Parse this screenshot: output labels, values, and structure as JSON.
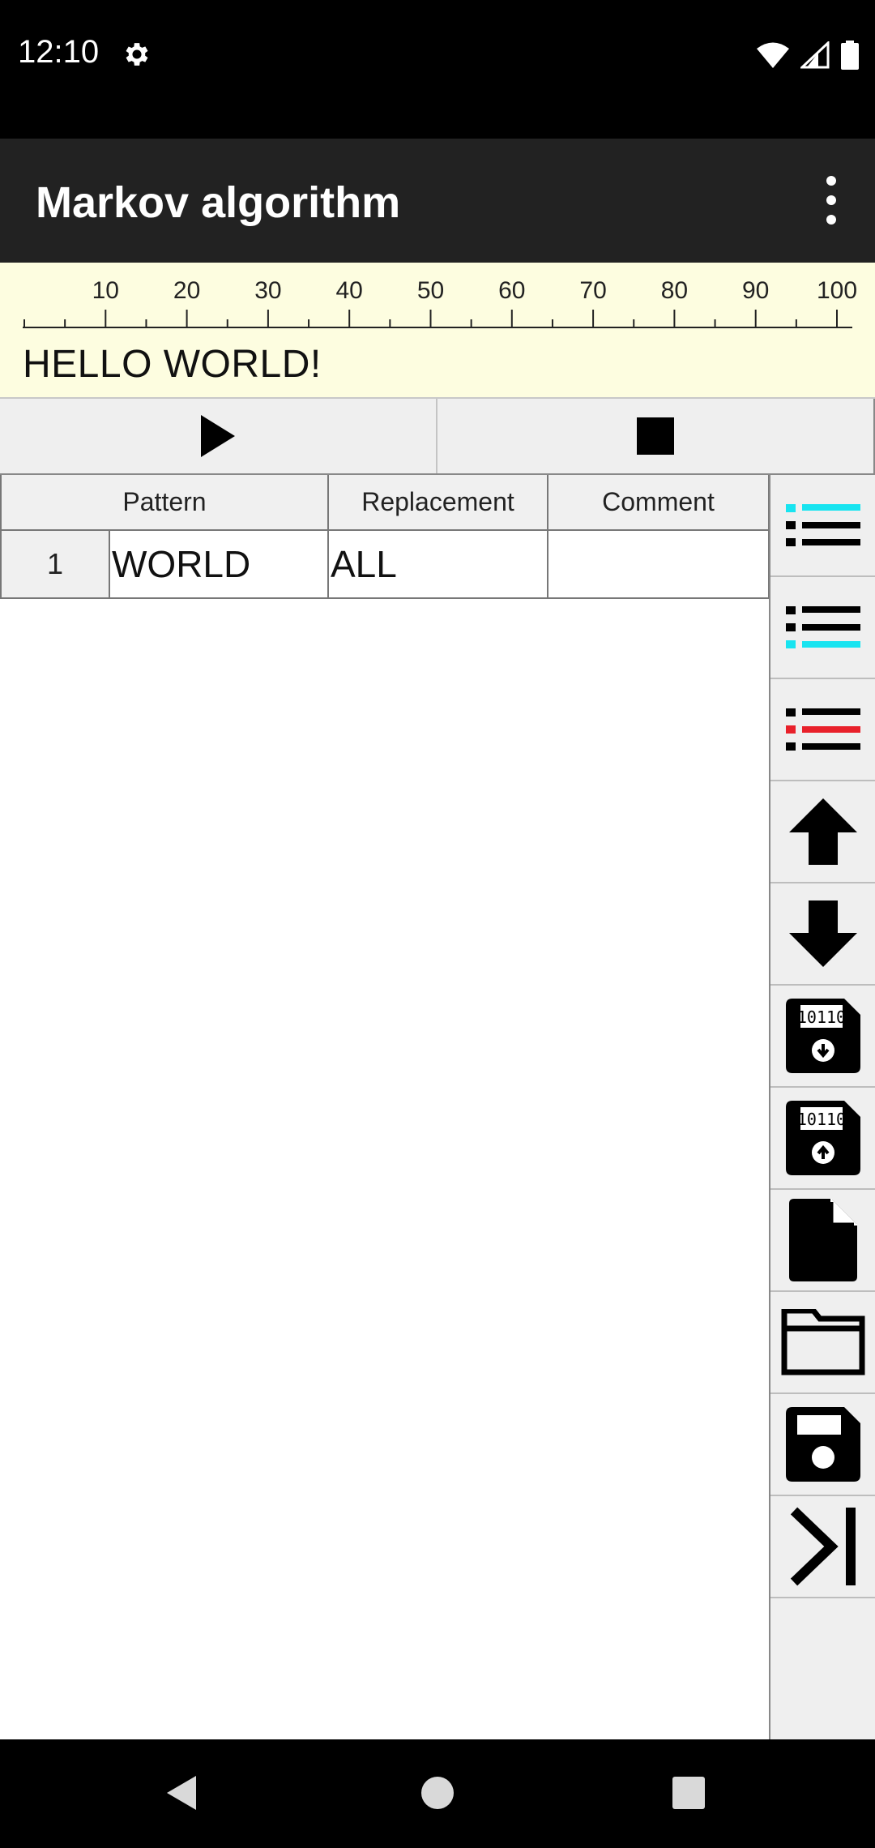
{
  "status_bar": {
    "time": "12:10",
    "settings_icon": "gear-icon",
    "wifi_icon": "wifi-icon",
    "signal_icon": "cell-signal-icon",
    "battery_icon": "battery-icon"
  },
  "app_bar": {
    "title": "Markov algorithm",
    "menu_icon": "more-vert-icon"
  },
  "ruler": {
    "labels": [
      "10",
      "20",
      "30",
      "40",
      "50",
      "60",
      "70",
      "80",
      "90",
      "100"
    ]
  },
  "tape": {
    "text": "HELLO WORLD!"
  },
  "controls": {
    "play_icon": "play-icon",
    "stop_icon": "stop-icon"
  },
  "table": {
    "headers": [
      "Pattern",
      "Replacement",
      "Comment"
    ],
    "rows": [
      {
        "num": "1",
        "pattern": "WORLD",
        "replacement": "ALL",
        "comment": ""
      }
    ]
  },
  "toolbar": {
    "icons": [
      "insert-row-above-icon",
      "insert-row-below-icon",
      "delete-row-icon",
      "move-up-icon",
      "move-down-icon",
      "import-data-icon",
      "export-data-icon",
      "new-file-icon",
      "open-folder-icon",
      "save-icon",
      "step-icon"
    ]
  },
  "colors": {
    "accent_cyan": "#18e4f0",
    "accent_red": "#e8202a",
    "tape_background": "#fdfde0",
    "app_bar": "#222222"
  }
}
